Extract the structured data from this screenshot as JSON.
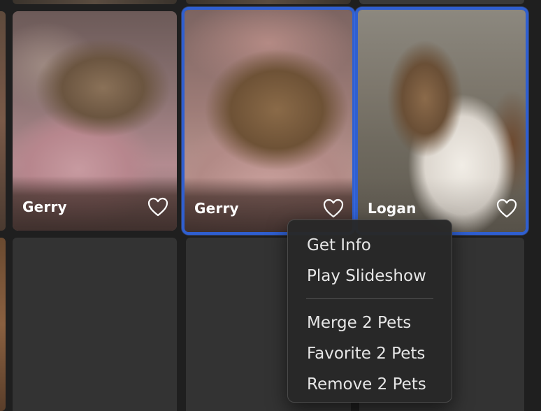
{
  "pets": [
    {
      "name": "Gerry",
      "favorite": false,
      "selected": false,
      "photo": "dog-sleeping-on-pink-blanket"
    },
    {
      "name": "Gerry",
      "favorite": false,
      "selected": true,
      "photo": "dog-sleeping-in-pink-bed"
    },
    {
      "name": "Logan",
      "favorite": false,
      "selected": true,
      "photo": "collie-standing-in-field"
    }
  ],
  "context_menu": {
    "items_top": [
      "Get Info",
      "Play Slideshow"
    ],
    "items_bottom": [
      "Merge 2 Pets",
      "Favorite 2 Pets",
      "Remove 2 Pets"
    ]
  },
  "colors": {
    "background": "#1f1f1f",
    "selection_border": "#2f5fd0",
    "empty_tile": "#333333",
    "menu_bg": "#282828",
    "menu_text": "#e6e6e6"
  },
  "icons": {
    "favorite": "heart-outline-icon"
  }
}
